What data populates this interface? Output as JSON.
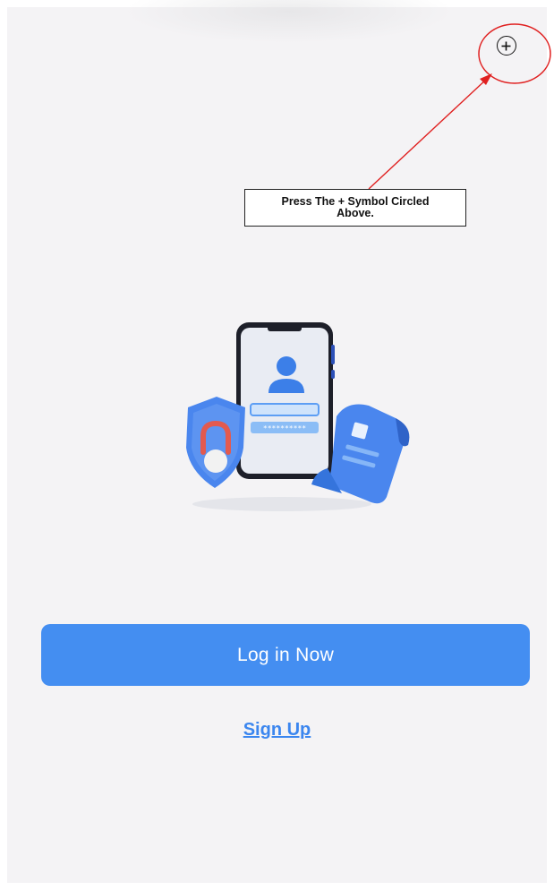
{
  "annotation": {
    "instruction": "Press The + Symbol Circled Above.",
    "highlight_color": "#e02020"
  },
  "header": {
    "add_icon": "plus-circle-icon"
  },
  "illustration": {
    "password_mask": "**********",
    "accent_color": "#4a86ee",
    "lock_color": "#e25a4f"
  },
  "actions": {
    "login_label": "Log in Now",
    "signup_label": "Sign Up",
    "primary_color": "#448ef1"
  }
}
